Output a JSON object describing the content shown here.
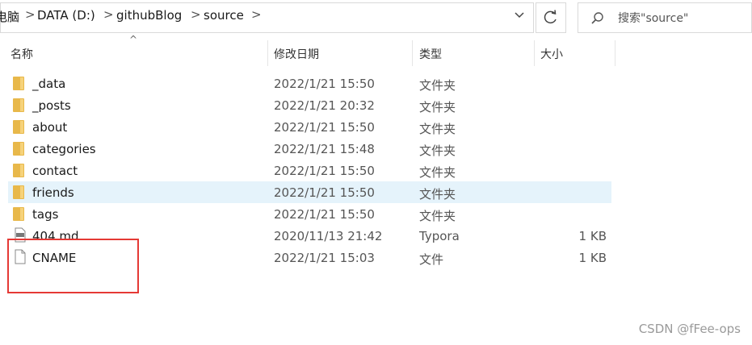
{
  "breadcrumb": {
    "items": [
      "电脑",
      "DATA (D:)",
      "githubBlog",
      "source"
    ],
    "separator": ">"
  },
  "search": {
    "placeholder": "搜索\"source\""
  },
  "columns": {
    "name": "名称",
    "modified": "修改日期",
    "type": "类型",
    "size": "大小"
  },
  "files": [
    {
      "name": "_data",
      "modified": "2022/1/21 15:50",
      "type": "文件夹",
      "size": "",
      "kind": "folder",
      "selected": false
    },
    {
      "name": "_posts",
      "modified": "2022/1/21 20:32",
      "type": "文件夹",
      "size": "",
      "kind": "folder",
      "selected": false
    },
    {
      "name": "about",
      "modified": "2022/1/21 15:50",
      "type": "文件夹",
      "size": "",
      "kind": "folder",
      "selected": false
    },
    {
      "name": "categories",
      "modified": "2022/1/21 15:48",
      "type": "文件夹",
      "size": "",
      "kind": "folder",
      "selected": false
    },
    {
      "name": "contact",
      "modified": "2022/1/21 15:50",
      "type": "文件夹",
      "size": "",
      "kind": "folder",
      "selected": false
    },
    {
      "name": "friends",
      "modified": "2022/1/21 15:50",
      "type": "文件夹",
      "size": "",
      "kind": "folder",
      "selected": true
    },
    {
      "name": "tags",
      "modified": "2022/1/21 15:50",
      "type": "文件夹",
      "size": "",
      "kind": "folder",
      "selected": false
    },
    {
      "name": "404.md",
      "modified": "2020/11/13 21:42",
      "type": "Typora",
      "size": "1 KB",
      "kind": "markdown",
      "selected": false
    },
    {
      "name": "CNAME",
      "modified": "2022/1/21 15:03",
      "type": "文件",
      "size": "1 KB",
      "kind": "file",
      "selected": false
    }
  ],
  "watermark": "CSDN @fFee-ops",
  "colors": {
    "selection": "#e5f3fb",
    "folder": "#e8b84a",
    "highlight_box": "#e53935"
  }
}
